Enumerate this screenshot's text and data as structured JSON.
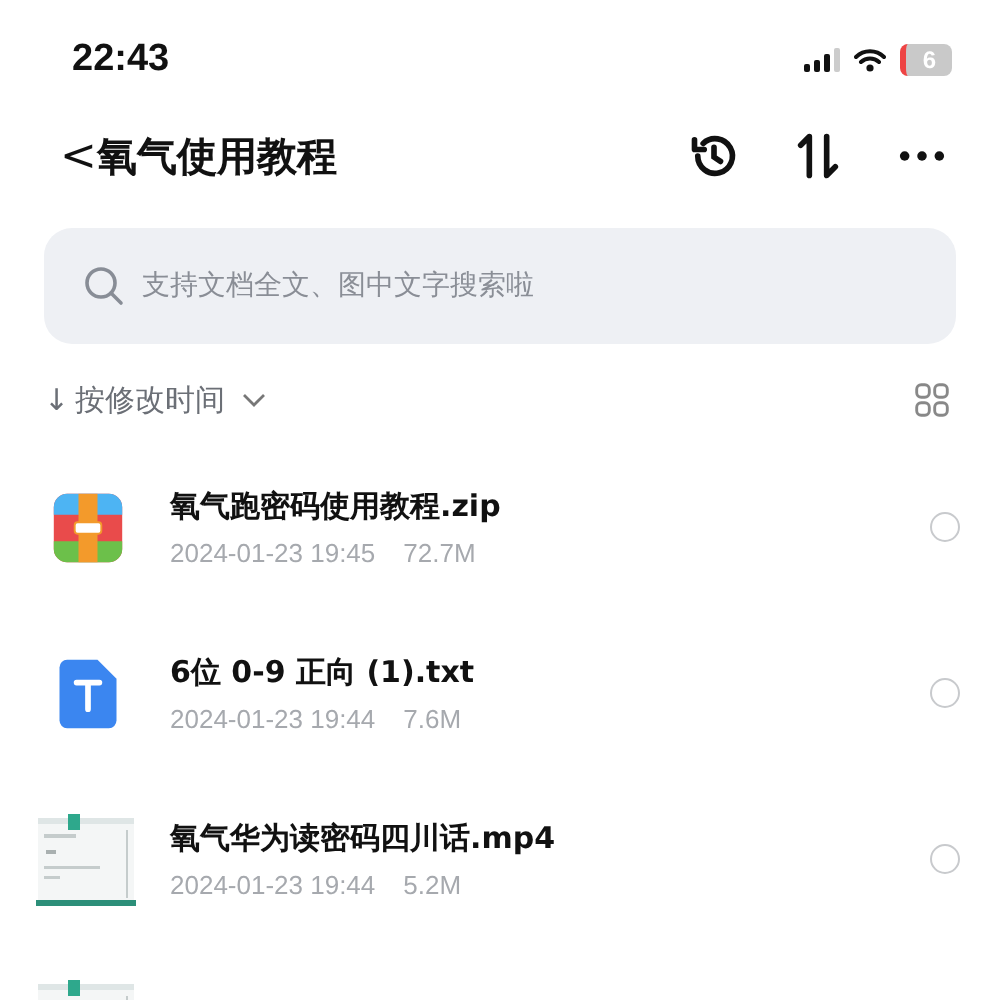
{
  "status_bar": {
    "time": "22:43",
    "battery": "6"
  },
  "nav": {
    "back": "<",
    "title": "氧气使用教程"
  },
  "search": {
    "placeholder": "支持文档全文、图中文字搜索啦"
  },
  "sort": {
    "arrow": "↓",
    "label": "按修改时间"
  },
  "files": [
    {
      "kind": "zip",
      "name": "氧气跑密码使用教程.zip",
      "date": "2024-01-23 19:45",
      "size": "72.7M",
      "selected": false
    },
    {
      "kind": "txt",
      "name": "6位 0-9 正向 (1).txt",
      "date": "2024-01-23 19:44",
      "size": "7.6M",
      "selected": false
    },
    {
      "kind": "video",
      "name": "氧气华为读密码四川话.mp4",
      "date": "2024-01-23 19:44",
      "size": "5.2M",
      "selected": false
    },
    {
      "kind": "video"
    }
  ]
}
